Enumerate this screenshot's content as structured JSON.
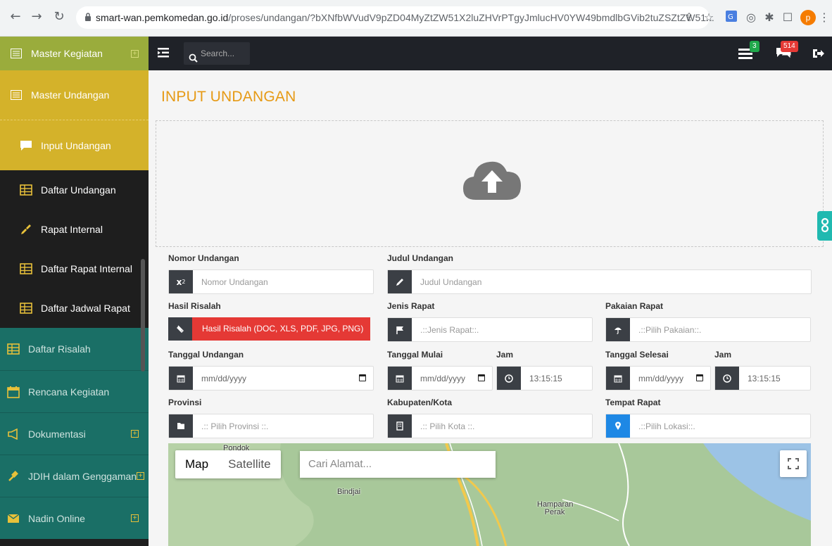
{
  "browser": {
    "url_host": "smart-wan.pemkomedan.go.id",
    "url_path": "/proses/undangan/?bXNfbWVudV9pZD04MyZtZW51X2luZHVrPTgyJmlucHV0YW49bmdlbGVib2tuZSZtZW51..."
  },
  "profile_initial": "p",
  "sidebar": {
    "items": [
      {
        "label": "Master Kegiatan"
      },
      {
        "label": "Master Undangan"
      },
      {
        "label": "Input Undangan"
      },
      {
        "label": "Daftar Undangan"
      },
      {
        "label": "Rapat Internal"
      },
      {
        "label": "Daftar Rapat Internal"
      },
      {
        "label": "Daftar Jadwal Rapat"
      },
      {
        "label": "Daftar Risalah"
      },
      {
        "label": "Rencana Kegiatan"
      },
      {
        "label": "Dokumentasi"
      },
      {
        "label": "JDIH dalam Genggaman"
      },
      {
        "label": "Nadin Online"
      }
    ]
  },
  "topbar": {
    "search_placeholder": "Search...",
    "tasks_count": "3",
    "messages_count": "514"
  },
  "page": {
    "title": "INPUT UNDANGAN"
  },
  "form": {
    "nomor_label": "Nomor Undangan",
    "nomor_placeholder": "Nomor Undangan",
    "judul_label": "Judul Undangan",
    "judul_placeholder": "Judul Undangan",
    "hasil_label": "Hasil Risalah",
    "hasil_button": "Hasil Risalah (DOC, XLS, PDF, JPG, PNG)",
    "jenis_label": "Jenis Rapat",
    "jenis_placeholder": ".::Jenis Rapat::.",
    "pakaian_label": "Pakaian Rapat",
    "pakaian_placeholder": ".::Pilih Pakaian::.",
    "tgl_undangan_label": "Tanggal Undangan",
    "tgl_undangan_value": "mm/dd/yyyy",
    "tgl_mulai_label": "Tanggal Mulai",
    "tgl_mulai_value": "mm/dd/yyyy",
    "jam_mulai_label": "Jam",
    "jam_mulai_value": "13:15:15",
    "tgl_selesai_label": "Tanggal Selesai",
    "tgl_selesai_value": "mm/dd/yyyy",
    "jam_selesai_label": "Jam",
    "jam_selesai_value": "13:15:15",
    "provinsi_label": "Provinsi",
    "provinsi_placeholder": ".:: Pilih Provinsi ::.",
    "kota_label": "Kabupaten/Kota",
    "kota_placeholder": ".:: Pilih Kota ::.",
    "tempat_label": "Tempat Rapat",
    "tempat_placeholder": ".::Pilih Lokasi::."
  },
  "map": {
    "map_tab": "Map",
    "satellite_tab": "Satellite",
    "search_placeholder": "Cari Alamat...",
    "labels": [
      "Pondok",
      "Bindjai",
      "Hamparan Perak"
    ]
  },
  "colors": {
    "sidebar_green": "#9aac3c",
    "sidebar_gold": "#d4b22a",
    "sidebar_teal": "#1a6f66",
    "title_orange": "#e69a15",
    "danger": "#e53935"
  }
}
